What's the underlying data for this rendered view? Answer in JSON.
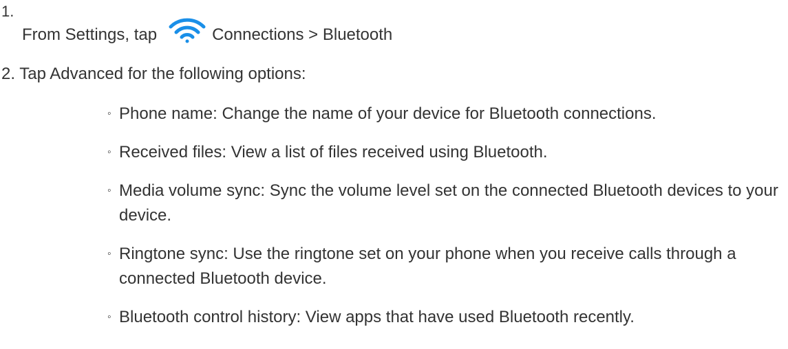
{
  "step1": {
    "number": "1.",
    "before_icon": "From Settings, tap",
    "icon": "wifi-icon",
    "after_icon": "Connections > Bluetooth",
    "icon_color": "#1a8fe8"
  },
  "step2": {
    "text": "2. Tap Advanced for the following options:"
  },
  "options": [
    {
      "bullet": "◦",
      "text": "Phone name: Change the name of your device for Bluetooth connections."
    },
    {
      "bullet": "◦",
      "text": "Received files: View a list of files received using Bluetooth."
    },
    {
      "bullet": "◦",
      "text": "Media volume sync: Sync the volume level set on the connected Bluetooth devices to your device."
    },
    {
      "bullet": "◦",
      "text": "Ringtone sync: Use the ringtone set on your phone when you receive calls through a connected Bluetooth device."
    },
    {
      "bullet": "◦",
      "text": "Bluetooth control history: View apps that have used Bluetooth recently."
    }
  ]
}
